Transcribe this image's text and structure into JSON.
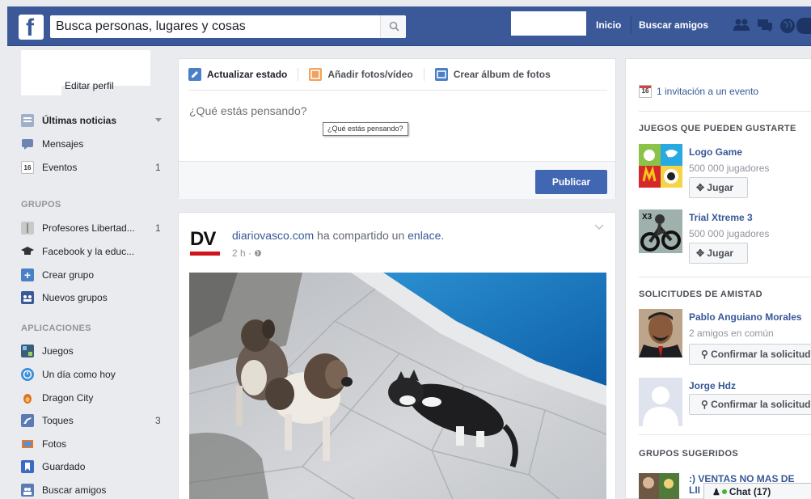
{
  "header": {
    "search_placeholder": "Busca personas, lugares y cosas",
    "nav_home": "Inicio",
    "nav_find_friends": "Buscar amigos",
    "logo": "f",
    "icons": [
      "friend-requests-icon",
      "messages-icon",
      "notifications-globe-icon"
    ]
  },
  "left_nav": {
    "edit_profile": "Editar perfil",
    "main_items": [
      {
        "label": "Últimas noticias",
        "icon": "news-feed-icon",
        "count": ""
      },
      {
        "label": "Mensajes",
        "icon": "messages-icon",
        "count": ""
      },
      {
        "label": "Eventos",
        "icon": "events-calendar-icon",
        "count": "1"
      }
    ],
    "groups_heading": "GRUPOS",
    "groups": [
      {
        "label": "Profesores Libertad...",
        "icon": "book-icon",
        "count": "1"
      },
      {
        "label": "Facebook y la educ...",
        "icon": "graduation-cap-icon",
        "count": ""
      },
      {
        "label": "Crear grupo",
        "icon": "plus-icon",
        "count": ""
      },
      {
        "label": "Nuevos grupos",
        "icon": "groups-icon",
        "count": ""
      }
    ],
    "apps_heading": "APLICACIONES",
    "apps": [
      {
        "label": "Juegos",
        "icon": "games-icon",
        "count": ""
      },
      {
        "label": "Un día como hoy",
        "icon": "on-this-day-clock-icon",
        "count": ""
      },
      {
        "label": "Dragon City",
        "icon": "dragon-city-icon",
        "count": ""
      },
      {
        "label": "Toques",
        "icon": "poke-icon",
        "count": "3"
      },
      {
        "label": "Fotos",
        "icon": "photos-icon",
        "count": ""
      },
      {
        "label": "Guardado",
        "icon": "saved-bookmark-icon",
        "count": ""
      },
      {
        "label": "Buscar amigos",
        "icon": "find-friends-icon",
        "count": ""
      }
    ]
  },
  "composer": {
    "tab_status": "Actualizar estado",
    "tab_photo": "Añadir fotos/vídeo",
    "tab_album": "Crear álbum de fotos",
    "placeholder": "¿Qué estás pensando?",
    "tooltip": "¿Qué estás pensando?",
    "publish": "Publicar"
  },
  "post": {
    "logo_text": "DV",
    "author": "diariovasco.com",
    "verb": "ha compartido un",
    "object": "enlace",
    "period": ".",
    "time": "2 h ·"
  },
  "right_col": {
    "event_invite": "1 invitación a un evento",
    "cal_day": "16",
    "games_heading": "JUEGOS QUE PUEDEN GUSTARTE",
    "games": [
      {
        "title": "Logo Game",
        "players": "500 000 jugadores",
        "button": "Jugar"
      },
      {
        "title": "Trial Xtreme 3",
        "players": "500 000 jugadores",
        "button": "Jugar"
      }
    ],
    "requests_heading": "SOLICITUDES DE AMISTAD",
    "requests": [
      {
        "name": "Pablo Anguiano Morales",
        "mutual": "2 amigos en común",
        "button": "Confirmar la solicitud"
      },
      {
        "name": "Jorge Hdz",
        "mutual": "",
        "button": "Confirmar la solicitud"
      }
    ],
    "groups_heading": "GRUPOS SUGERIDOS",
    "group_name": ":) VENTAS NO MAS DE",
    "group_name2": "LII"
  },
  "chat": {
    "label": "Chat (17)"
  },
  "colors": {
    "brand_blue": "#3b5998",
    "link_blue": "#365899",
    "publish_blue": "#4267b2",
    "background": "#e9ebee"
  }
}
